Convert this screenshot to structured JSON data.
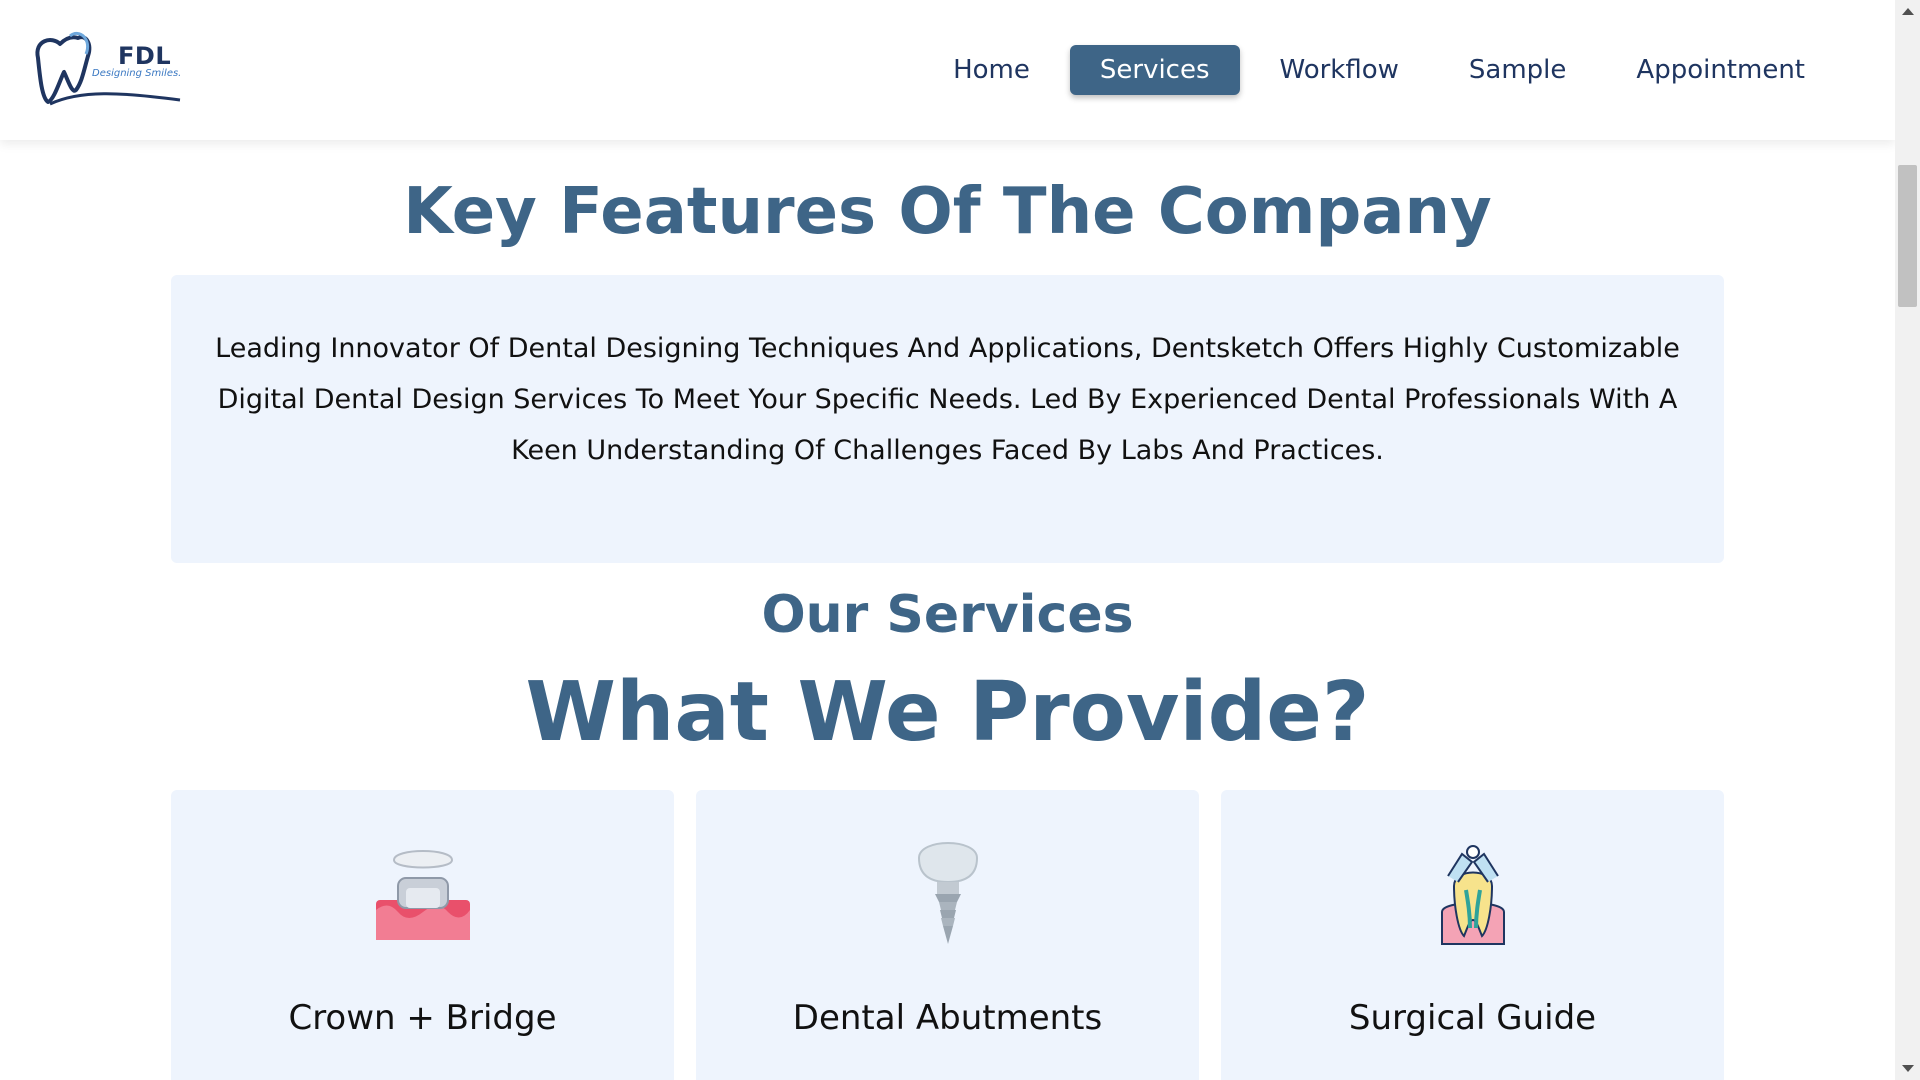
{
  "logo": {
    "name": "FDL",
    "tagline": "Designing Smiles."
  },
  "nav": {
    "items": [
      {
        "label": "Home",
        "active": false
      },
      {
        "label": "Services",
        "active": true
      },
      {
        "label": "Workflow",
        "active": false
      },
      {
        "label": "Sample",
        "active": false
      },
      {
        "label": "Appointment",
        "active": false
      }
    ]
  },
  "features": {
    "title": "Key Features Of The Company",
    "description": "Leading Innovator Of Dental Designing Techniques And Applications, Dentsketch Offers Highly Customizable Digital Dental Design Services To Meet Your Specific Needs. Led By Experienced Dental Professionals With A Keen Understanding Of Challenges Faced By Labs And Practices."
  },
  "services": {
    "subtitle": "Our Services",
    "title": "What We Provide?",
    "cards": [
      {
        "title": "Crown + Bridge",
        "icon": "crown-bridge-icon"
      },
      {
        "title": "Dental Abutments",
        "icon": "dental-implant-icon"
      },
      {
        "title": "Surgical Guide",
        "icon": "surgical-guide-icon"
      }
    ]
  },
  "colors": {
    "primary": "#3e6587",
    "card_bg": "#eef4fd",
    "nav_text": "#1f3560"
  }
}
